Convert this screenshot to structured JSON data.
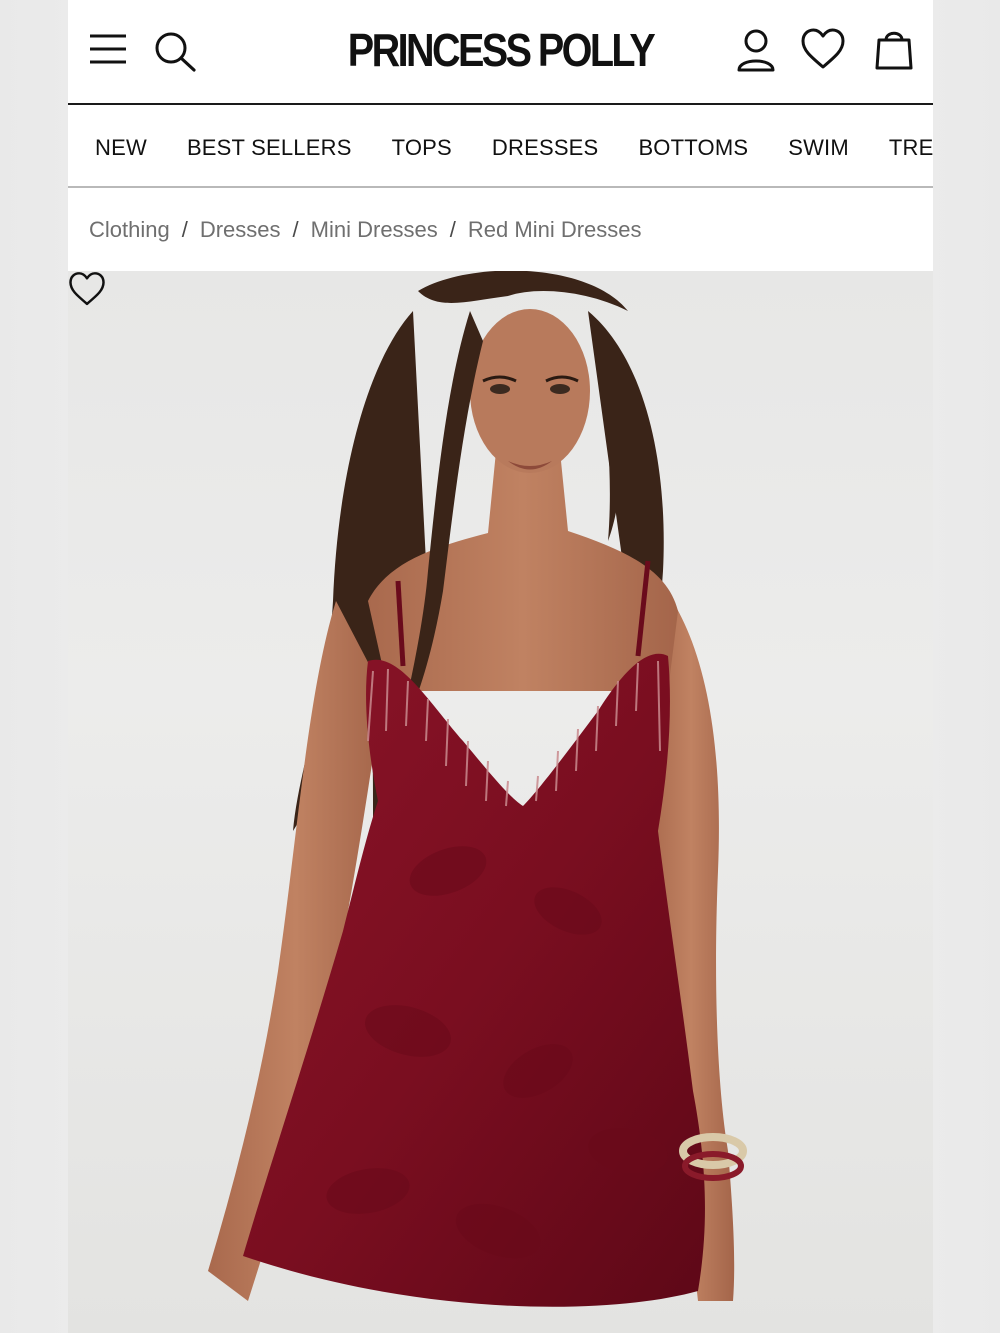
{
  "brand": {
    "name": "PRINCESS POLLY"
  },
  "header": {
    "menu_icon": "hamburger-menu-icon",
    "search_icon": "search-icon",
    "account_icon": "user-icon",
    "wishlist_icon": "heart-icon",
    "bag_icon": "shopping-bag-icon"
  },
  "category_nav": {
    "items": [
      {
        "label": "NEW"
      },
      {
        "label": "BEST SELLERS"
      },
      {
        "label": "TOPS"
      },
      {
        "label": "DRESSES"
      },
      {
        "label": "BOTTOMS"
      },
      {
        "label": "SWIM"
      },
      {
        "label": "TREI"
      }
    ]
  },
  "breadcrumb": {
    "separator": "/",
    "items": [
      {
        "label": "Clothing"
      },
      {
        "label": "Dresses"
      },
      {
        "label": "Mini Dresses"
      },
      {
        "label": "Red Mini Dresses"
      }
    ]
  },
  "product_image": {
    "wishlist_icon": "heart-outline-icon",
    "colors": {
      "background": "#e8e8e6",
      "dress": "#7d0f22",
      "skin": "#b57659",
      "hair": "#3a2418"
    }
  }
}
